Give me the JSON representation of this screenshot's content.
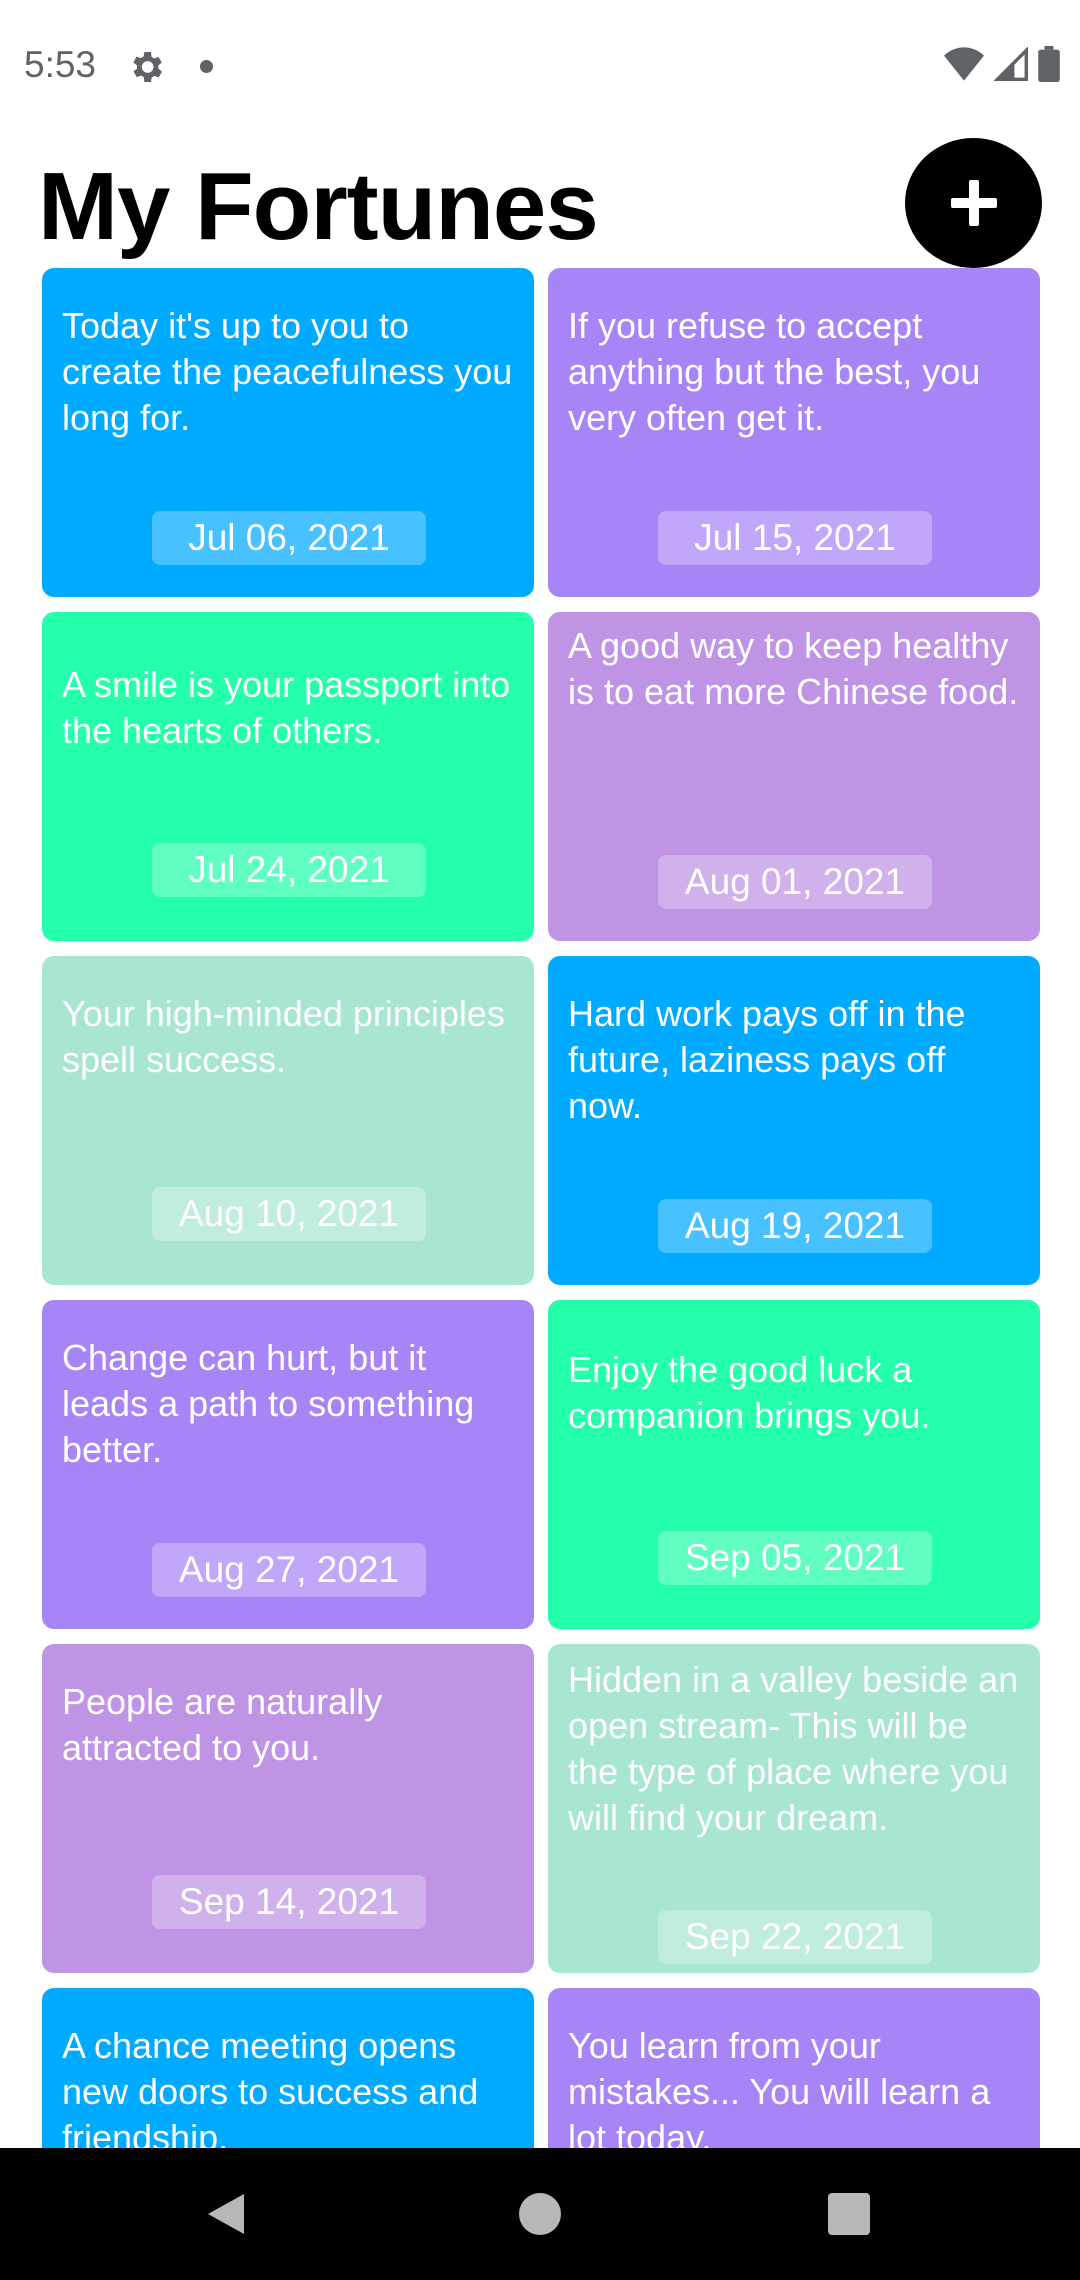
{
  "status_bar": {
    "time": "5:53",
    "icons": [
      "settings-icon",
      "notification-dot-icon",
      "wifi-icon",
      "signal-icon",
      "battery-icon"
    ]
  },
  "header": {
    "title": "My Fortunes",
    "add_button_icon": "plus-icon"
  },
  "colors": {
    "blue": "#00aaff",
    "purple": "#a885f7",
    "green": "#23ffaa",
    "lavender": "#bf94e4",
    "mint": "#a8e6cf"
  },
  "fortunes": [
    {
      "text": "Today it's up to you to create the peacefulness you long for.",
      "date": "Jul 06, 2021",
      "color": "blue"
    },
    {
      "text": "If you refuse to accept anything but the best, you very often get it.",
      "date": "Jul 15, 2021",
      "color": "purple"
    },
    {
      "text": "A smile is your passport into the hearts of others.",
      "date": "Jul 24, 2021",
      "color": "green"
    },
    {
      "text": "A good way to keep healthy is to eat more Chinese food.",
      "date": "Aug 01, 2021",
      "color": "lavender"
    },
    {
      "text": "Your high-minded principles spell success.",
      "date": "Aug 10, 2021",
      "color": "mint"
    },
    {
      "text": "Hard work pays off in the future, laziness pays off now.",
      "date": "Aug 19, 2021",
      "color": "blue"
    },
    {
      "text": "Change can hurt, but it leads a path to something better.",
      "date": "Aug 27, 2021",
      "color": "purple"
    },
    {
      "text": "Enjoy the good luck a companion brings you.",
      "date": "Sep 05, 2021",
      "color": "green"
    },
    {
      "text": "People are naturally attracted to you.",
      "date": "Sep 14, 2021",
      "color": "lavender"
    },
    {
      "text": "Hidden in a valley beside an open stream- This will be the type of place where you will find your dream.",
      "date": "Sep 22, 2021",
      "color": "mint"
    },
    {
      "text": "A chance meeting opens new doors to success and friendship.",
      "date": "",
      "color": "blue"
    },
    {
      "text": "You learn from your mistakes... You will learn a lot today.",
      "date": "",
      "color": "purple"
    }
  ],
  "nav_bar": {
    "buttons": [
      "back-icon",
      "home-icon",
      "recents-icon"
    ]
  }
}
